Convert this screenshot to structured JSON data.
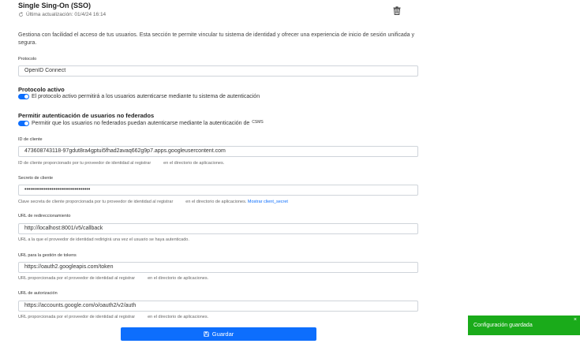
{
  "header": {
    "title": "Single Sing-On (SSO)",
    "updated": "Última actualización: 01/4/24 16:14",
    "description": "Gestiona con facilidad el acceso de tus usuarios. Esta sección te permite vincular tu sistema de identidad y ofrecer una experiencia de inicio de sesión unificada y segura."
  },
  "protocol": {
    "label": "Protocolo",
    "value": "OpenID Connect"
  },
  "active_protocol": {
    "title": "Protocolo activo",
    "toggle_text": "El protocolo activo permitirá a los usuarios autenticarse mediante tu sistema de autenticación",
    "enabled": true
  },
  "non_federated": {
    "title": "Permitir autenticación de usuarios no federados",
    "toggle_text": "Permitir que los usuarios no federados puedan autenticarse mediante la autenticación de",
    "suffix": "CSMS",
    "enabled": true
  },
  "client_id": {
    "label": "ID de cliente",
    "value": "473608743118-97gdut8ra4gptui5fhad2avaq662g9p7.apps.googleusercontent.com",
    "help_a": "ID de cliente proporcionado por tu proveedor de identidad al registrar",
    "help_b": "en el directorio de aplicaciones."
  },
  "client_secret": {
    "label": "Secreto de cliente",
    "value": "••••••••••••••••••••••••••••••••••",
    "help_a": "Clave secreta de cliente proporcionada por tu proveedor de identidad al registrar",
    "help_b": "en el directorio de aplicaciones.",
    "link": "Mostrar client_secret"
  },
  "redirect_url": {
    "label": "URL de redireccionamiento",
    "value": "http://localhost:8001/v5/callback",
    "help": "URL a la que el proveedor de identidad redirigirá una vez el usuario se haya autenticado."
  },
  "token_url": {
    "label": "URL para la gestión de tokens",
    "value": "https://oauth2.googleapis.com/token",
    "help_a": "URL proporcionada por el proveedor de identidad al registrar",
    "help_b": "en el directorio de aplicaciones."
  },
  "auth_url": {
    "label": "URL de autorización",
    "value": "https://accounts.google.com/o/oauth2/v2/auth",
    "help_a": "URL proporcionada por el proveedor de identidad al registrar",
    "help_b": "en el directorio de aplicaciones."
  },
  "save_button": {
    "label": "Guardar"
  },
  "toast": {
    "message": "Configuración guardada",
    "close": "×"
  },
  "colors": {
    "primary": "#0d6efd",
    "success": "#1aab1a"
  }
}
